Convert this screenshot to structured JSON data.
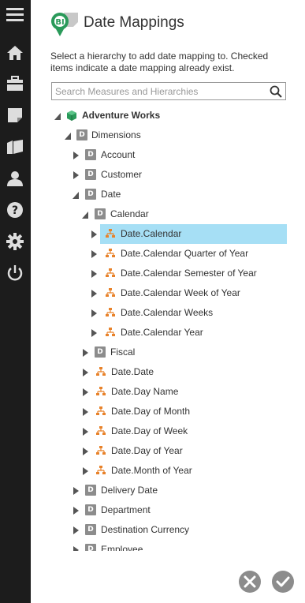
{
  "dialog": {
    "title": "Date Mappings",
    "description": "Select a hierarchy to add date mapping to. Checked items indicate a date mapping already exist.",
    "logo_badge": "BI"
  },
  "search": {
    "placeholder": "Search Measures and Hierarchies",
    "value": ""
  },
  "sidebar": {
    "icons": [
      "menu-icon",
      "home-icon",
      "briefcase-icon",
      "note-icon",
      "folder-open-icon",
      "user-icon",
      "help-icon",
      "gear-icon",
      "power-icon"
    ]
  },
  "tree": {
    "root": "Adventure Works",
    "dimensions": "Dimensions",
    "account": "Account",
    "customer": "Customer",
    "date": "Date",
    "calendar": "Calendar",
    "date_calendar": "Date.Calendar",
    "date_calendar_quarter": "Date.Calendar Quarter of Year",
    "date_calendar_semester": "Date.Calendar Semester of Year",
    "date_calendar_week_of_year": "Date.Calendar Week of Year",
    "date_calendar_weeks": "Date.Calendar Weeks",
    "date_calendar_year": "Date.Calendar Year",
    "fiscal": "Fiscal",
    "date_date": "Date.Date",
    "date_day_name": "Date.Day Name",
    "date_day_of_month": "Date.Day of Month",
    "date_day_of_week": "Date.Day of Week",
    "date_day_of_year": "Date.Day of Year",
    "date_month_of_year": "Date.Month of Year",
    "delivery_date": "Delivery Date",
    "department": "Department",
    "destination_currency": "Destination Currency",
    "employee": "Employee"
  },
  "colors": {
    "sidebar": "#1c1c1c",
    "selected": "#a6dff5",
    "hierarchy_icon": "#e8822a",
    "cube_icon": "#2a9a5a",
    "button_grey": "#8c8c8c"
  }
}
